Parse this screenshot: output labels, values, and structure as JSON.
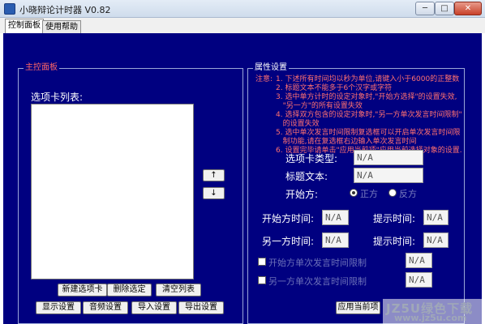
{
  "window": {
    "title": "小晓辩论计时器 V0.82",
    "min_label": "─",
    "max_label": "□",
    "close_label": "✕"
  },
  "tabs": [
    {
      "label": "控制面板",
      "active": true
    },
    {
      "label": "使用帮助",
      "active": false
    }
  ],
  "main_panel": {
    "legend": "主控面板",
    "list_label": "选项卡列表:",
    "arrow_up": "↑",
    "arrow_down": "↓",
    "buttons_row1": [
      "新建选项卡",
      "删除选定",
      "清空列表"
    ],
    "buttons_row2": [
      "显示设置",
      "音频设置",
      "导入设置",
      "导出设置"
    ]
  },
  "properties": {
    "legend": "属性设置",
    "notes_prefix": "注意:",
    "notes": [
      "1. 下述所有时间均以秒为单位,请键入小于6000的正整数",
      "2. 标题文本不能多于6个汉字或字符",
      "3. 选中单方计时的设定对象时,\"开始方选择\"的设置失效,",
      "   \"另一方\"的所有设置失效",
      "4. 选择双方包含的设定对象时,\"另一方单次发言时间限制\"",
      "   的设置失效",
      "5. 选中单次发言时间限制复选框可以开启单次发言时间限",
      "   制功能,请在复选框右边输入单次发言时间",
      "6. 设置完毕请单击\"应用当前项\"应用当前选择对象的设置."
    ],
    "tab_type_label": "选项卡类型:",
    "tab_type_value": "N/A",
    "title_text_label": "标题文本:",
    "title_text_value": "N/A",
    "start_side_label": "开始方:",
    "radio_options": [
      {
        "label": "正方",
        "selected": true
      },
      {
        "label": "反方",
        "selected": false
      }
    ],
    "start_time_label": "开始方时间:",
    "start_time_value": "N/A",
    "hint_time_label_1": "提示时间:",
    "hint_time_value_1": "N/A",
    "other_time_label": "另一方时间:",
    "other_time_value": "N/A",
    "hint_time_label_2": "提示时间:",
    "hint_time_value_2": "N/A",
    "checkbox_1_label": "开始方单次发言时间限制",
    "checkbox_1_value": "N/A",
    "checkbox_2_label": "另一方单次发言时间限制",
    "checkbox_2_value": "N/A",
    "apply_button": "应用当前项"
  },
  "watermark": {
    "line1": "JZ5U绿色下载",
    "line2": "www.jz5u.com"
  }
}
